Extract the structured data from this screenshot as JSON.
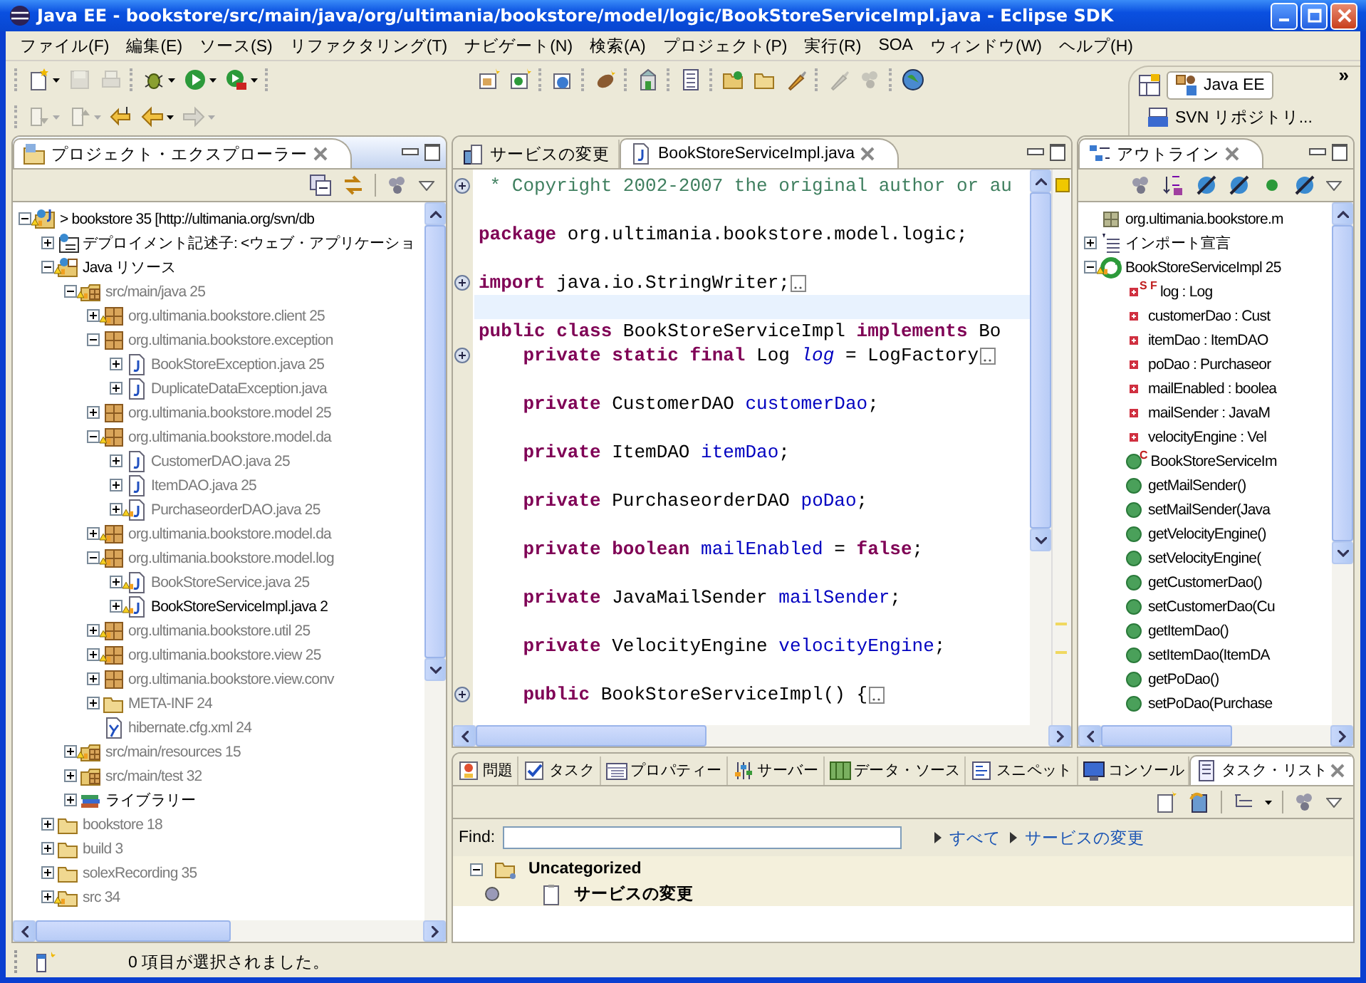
{
  "window": {
    "title": "Java EE - bookstore/src/main/java/org/ultimania/bookstore/model/logic/BookStoreServiceImpl.java - Eclipse SDK"
  },
  "menu": [
    "ファイル(F)",
    "編集(E)",
    "ソース(S)",
    "リファクタリング(T)",
    "ナビゲート(N)",
    "検索(A)",
    "プロジェクト(P)",
    "実行(R)",
    "SOA",
    "ウィンドウ(W)",
    "ヘルプ(H)"
  ],
  "toolbar": {
    "row_1": [
      [
        {
          "kind": "new",
          "enabled": true,
          "dropdown": true
        },
        {
          "kind": "save",
          "enabled": false,
          "dropdown": false
        },
        {
          "kind": "print",
          "enabled": false,
          "dropdown": false
        }
      ],
      [
        {
          "kind": "debug",
          "enabled": true,
          "dropdown": true
        },
        {
          "kind": "run",
          "enabled": true,
          "dropdown": true
        },
        {
          "kind": "ext",
          "enabled": true,
          "dropdown": true
        }
      ],
      [
        {
          "kind": "newpkg",
          "enabled": true,
          "dropdown": false
        },
        {
          "kind": "newclass",
          "enabled": true,
          "dropdown": false
        }
      ],
      [
        {
          "kind": "newweb",
          "enabled": true,
          "dropdown": false
        }
      ],
      [
        {
          "kind": "bean",
          "enabled": true,
          "dropdown": false
        }
      ],
      [
        {
          "kind": "server",
          "enabled": true,
          "dropdown": false
        }
      ],
      [
        {
          "kind": "doc",
          "enabled": true,
          "dropdown": false
        }
      ],
      [
        {
          "kind": "openfolder",
          "enabled": true,
          "dropdown": false
        },
        {
          "kind": "folder",
          "enabled": true,
          "dropdown": false
        },
        {
          "kind": "brush",
          "enabled": true,
          "dropdown": false
        }
      ],
      [
        {
          "kind": "brush",
          "enabled": false,
          "dropdown": false
        },
        {
          "kind": "balls",
          "enabled": false,
          "dropdown": false
        }
      ],
      [
        {
          "kind": "globe",
          "enabled": true,
          "dropdown": false
        }
      ]
    ],
    "row_2": [
      [
        {
          "kind": "down",
          "enabled": false,
          "dropdown": true
        },
        {
          "kind": "up",
          "enabled": false,
          "dropdown": true
        },
        {
          "kind": "lastedit",
          "enabled": true,
          "dropdown": false
        },
        {
          "kind": "back",
          "enabled": true,
          "dropdown": true
        },
        {
          "kind": "forward",
          "enabled": false,
          "dropdown": true
        }
      ]
    ]
  },
  "perspectives": {
    "items": [
      {
        "label": "Java EE",
        "selected": true
      },
      {
        "label": "SVN リポジトリ...",
        "selected": false
      }
    ],
    "more": "»"
  },
  "explorer": {
    "tab": "プロジェクト・エクスプローラー",
    "tree": [
      {
        "label": "> bookstore 35 [http://ultimania.org/svn/db",
        "kind": "project",
        "expanded": true,
        "warning": true,
        "dimmed": false,
        "children": [
          {
            "label": "デプロイメント記述子: <ウェブ・アプリケーショ",
            "kind": "deploy",
            "expanded": false,
            "warning": false,
            "dimmed": false
          },
          {
            "label": "Java リソース",
            "kind": "javares",
            "expanded": true,
            "warning": true,
            "dimmed": false,
            "children": [
              {
                "label": "src/main/java 25",
                "kind": "srcfolder",
                "expanded": true,
                "warning": true,
                "dimmed": true,
                "children": [
                  {
                    "label": "org.ultimania.bookstore.client 25",
                    "kind": "package",
                    "expanded": false,
                    "warning": true,
                    "dimmed": true
                  },
                  {
                    "label": "org.ultimania.bookstore.exception",
                    "kind": "package",
                    "expanded": true,
                    "warning": false,
                    "dimmed": true,
                    "children": [
                      {
                        "label": "BookStoreException.java 25",
                        "kind": "javafile",
                        "expanded": false,
                        "warning": false,
                        "dimmed": true
                      },
                      {
                        "label": "DuplicateDataException.java",
                        "kind": "javafile",
                        "expanded": false,
                        "warning": false,
                        "dimmed": true
                      }
                    ]
                  },
                  {
                    "label": "org.ultimania.bookstore.model 25",
                    "kind": "package",
                    "expanded": false,
                    "warning": false,
                    "dimmed": true
                  },
                  {
                    "label": "org.ultimania.bookstore.model.da",
                    "kind": "package",
                    "expanded": true,
                    "warning": true,
                    "dimmed": true,
                    "children": [
                      {
                        "label": "CustomerDAO.java 25",
                        "kind": "javafile",
                        "expanded": false,
                        "warning": false,
                        "dimmed": true
                      },
                      {
                        "label": "ItemDAO.java 25",
                        "kind": "javafile",
                        "expanded": false,
                        "warning": false,
                        "dimmed": true
                      },
                      {
                        "label": "PurchaseorderDAO.java 25",
                        "kind": "javafile",
                        "expanded": false,
                        "warning": true,
                        "dimmed": true
                      }
                    ]
                  },
                  {
                    "label": "org.ultimania.bookstore.model.da",
                    "kind": "package",
                    "expanded": false,
                    "warning": true,
                    "dimmed": true
                  },
                  {
                    "label": "org.ultimania.bookstore.model.log",
                    "kind": "package",
                    "expanded": true,
                    "warning": true,
                    "dimmed": true,
                    "children": [
                      {
                        "label": "BookStoreService.java 25",
                        "kind": "javafile",
                        "expanded": false,
                        "warning": true,
                        "dimmed": true
                      },
                      {
                        "label": "BookStoreServiceImpl.java 2",
                        "kind": "javafile",
                        "expanded": false,
                        "warning": true,
                        "dimmed": false
                      }
                    ]
                  },
                  {
                    "label": "org.ultimania.bookstore.util 25",
                    "kind": "package",
                    "expanded": false,
                    "warning": true,
                    "dimmed": true
                  },
                  {
                    "label": "org.ultimania.bookstore.view 25",
                    "kind": "package",
                    "expanded": false,
                    "warning": true,
                    "dimmed": true
                  },
                  {
                    "label": "org.ultimania.bookstore.view.conv",
                    "kind": "package",
                    "expanded": false,
                    "warning": false,
                    "dimmed": true
                  },
                  {
                    "label": "META-INF 24",
                    "kind": "folder",
                    "expanded": false,
                    "warning": false,
                    "dimmed": true
                  },
                  {
                    "label": "hibernate.cfg.xml 24",
                    "kind": "xml",
                    "warning": false,
                    "dimmed": true
                  }
                ]
              },
              {
                "label": "src/main/resources 15",
                "kind": "srcfolder",
                "expanded": false,
                "warning": true,
                "dimmed": true
              },
              {
                "label": "src/main/test 32",
                "kind": "srcfolder",
                "expanded": false,
                "warning": false,
                "dimmed": true
              },
              {
                "label": "ライブラリー",
                "kind": "library",
                "expanded": false,
                "warning": false,
                "dimmed": false
              }
            ]
          },
          {
            "label": "bookstore 18",
            "kind": "folder",
            "expanded": false,
            "warning": false,
            "dimmed": true
          },
          {
            "label": "build 3",
            "kind": "folder",
            "expanded": false,
            "warning": false,
            "dimmed": true
          },
          {
            "label": "solexRecording 35",
            "kind": "folder",
            "expanded": false,
            "warning": false,
            "dimmed": true
          },
          {
            "label": "src 34",
            "kind": "folder",
            "expanded": false,
            "warning": true,
            "dimmed": true
          }
        ]
      }
    ]
  },
  "editor": {
    "tabs": [
      {
        "label": "サービスの変更",
        "selected": false
      },
      {
        "label": "BookStoreServiceImpl.java",
        "selected": true
      }
    ],
    "lines": [
      {
        "fold": true,
        "box": false,
        "current": false,
        "tokens": [
          {
            "kind": "comment",
            "text": " * Copyright 2002-2007 the original author or au"
          }
        ]
      },
      {
        "fold": false,
        "box": false,
        "current": false
      },
      {
        "fold": false,
        "box": false,
        "current": false,
        "tokens": [
          {
            "kind": "kw",
            "text": "package"
          },
          {
            "kind": "plain",
            "text": " org.ultimania.bookstore.model.logic;"
          }
        ]
      },
      {
        "fold": false,
        "box": false,
        "current": false
      },
      {
        "fold": true,
        "box": true,
        "current": false,
        "tokens": [
          {
            "kind": "kw",
            "text": "import"
          },
          {
            "kind": "plain",
            "text": " java.io.StringWriter;"
          }
        ]
      },
      {
        "fold": false,
        "box": false,
        "current": true
      },
      {
        "fold": false,
        "box": false,
        "current": false,
        "tokens": [
          {
            "kind": "kw",
            "text": "public class"
          },
          {
            "kind": "plain",
            "text": " BookStoreServiceImpl "
          },
          {
            "kind": "kw",
            "text": "implements"
          },
          {
            "kind": "plain",
            "text": " Bo"
          }
        ]
      },
      {
        "fold": true,
        "box": true,
        "current": false,
        "tokens": [
          {
            "kind": "kw",
            "text": "    private static final"
          },
          {
            "kind": "plain",
            "text": " Log "
          },
          {
            "kind": "static",
            "text": "log"
          },
          {
            "kind": "plain",
            "text": " = LogFactory"
          }
        ]
      },
      {
        "fold": false,
        "box": false,
        "current": false
      },
      {
        "fold": false,
        "box": false,
        "current": false,
        "tokens": [
          {
            "kind": "kw",
            "text": "    private"
          },
          {
            "kind": "plain",
            "text": " CustomerDAO "
          },
          {
            "kind": "field",
            "text": "customerDao"
          },
          {
            "kind": "plain",
            "text": ";"
          }
        ]
      },
      {
        "fold": false,
        "box": false,
        "current": false
      },
      {
        "fold": false,
        "box": false,
        "current": false,
        "tokens": [
          {
            "kind": "kw",
            "text": "    private"
          },
          {
            "kind": "plain",
            "text": " ItemDAO "
          },
          {
            "kind": "field",
            "text": "itemDao"
          },
          {
            "kind": "plain",
            "text": ";"
          }
        ]
      },
      {
        "fold": false,
        "box": false,
        "current": false
      },
      {
        "fold": false,
        "box": false,
        "current": false,
        "tokens": [
          {
            "kind": "kw",
            "text": "    private"
          },
          {
            "kind": "plain",
            "text": " PurchaseorderDAO "
          },
          {
            "kind": "field",
            "text": "poDao"
          },
          {
            "kind": "plain",
            "text": ";"
          }
        ]
      },
      {
        "fold": false,
        "box": false,
        "current": false
      },
      {
        "fold": false,
        "box": false,
        "current": false,
        "tokens": [
          {
            "kind": "kw",
            "text": "    private boolean"
          },
          {
            "kind": "field",
            "text": " mailEnabled"
          },
          {
            "kind": "plain",
            "text": " = "
          },
          {
            "kind": "kw",
            "text": "false"
          },
          {
            "kind": "plain",
            "text": ";"
          }
        ]
      },
      {
        "fold": false,
        "box": false,
        "current": false
      },
      {
        "fold": false,
        "box": false,
        "current": false,
        "tokens": [
          {
            "kind": "kw",
            "text": "    private"
          },
          {
            "kind": "plain",
            "text": " JavaMailSender "
          },
          {
            "kind": "field",
            "text": "mailSender"
          },
          {
            "kind": "plain",
            "text": ";"
          }
        ]
      },
      {
        "fold": false,
        "box": false,
        "current": false
      },
      {
        "fold": false,
        "box": false,
        "current": false,
        "tokens": [
          {
            "kind": "kw",
            "text": "    private"
          },
          {
            "kind": "plain",
            "text": " VelocityEngine "
          },
          {
            "kind": "field",
            "text": "velocityEngine"
          },
          {
            "kind": "plain",
            "text": ";"
          }
        ]
      },
      {
        "fold": false,
        "box": false,
        "current": false
      },
      {
        "fold": true,
        "box": true,
        "current": false,
        "tokens": [
          {
            "kind": "kw",
            "text": "    public"
          },
          {
            "kind": "plain",
            "text": " BookStoreServiceImpl() {"
          }
        ]
      }
    ]
  },
  "outline": {
    "tab": "アウトライン",
    "tree": [
      {
        "label": "org.ultimania.bookstore.m",
        "kind": "pkgdecl",
        "warning": false
      },
      {
        "label": "インポート宣言",
        "kind": "imports",
        "expanded": false,
        "warning": false
      },
      {
        "label": "BookStoreServiceImpl 25",
        "kind": "class",
        "expanded": true,
        "warning": true,
        "children": [
          {
            "label": "log : Log",
            "kind": "field",
            "badge": "S F"
          },
          {
            "label": "customerDao : Cust",
            "kind": "field"
          },
          {
            "label": "itemDao : ItemDAO",
            "kind": "field"
          },
          {
            "label": "poDao : Purchaseor",
            "kind": "field"
          },
          {
            "label": "mailEnabled : boolea",
            "kind": "field"
          },
          {
            "label": "mailSender : JavaM",
            "kind": "field"
          },
          {
            "label": "velocityEngine : Vel",
            "kind": "field"
          },
          {
            "label": "BookStoreServiceIm",
            "kind": "method",
            "badge": "C"
          },
          {
            "label": "getMailSender()",
            "kind": "method"
          },
          {
            "label": "setMailSender(Java",
            "kind": "method"
          },
          {
            "label": "getVelocityEngine()",
            "kind": "method"
          },
          {
            "label": "setVelocityEngine(",
            "kind": "method"
          },
          {
            "label": "getCustomerDao()",
            "kind": "method"
          },
          {
            "label": "setCustomerDao(Cu",
            "kind": "method"
          },
          {
            "label": "getItemDao()",
            "kind": "method"
          },
          {
            "label": "setItemDao(ItemDA",
            "kind": "method"
          },
          {
            "label": "getPoDao()",
            "kind": "method"
          },
          {
            "label": "setPoDao(Purchase",
            "kind": "method"
          }
        ]
      }
    ]
  },
  "bottom": {
    "tabs": [
      {
        "label": "問題",
        "selected": false
      },
      {
        "label": "タスク",
        "selected": false
      },
      {
        "label": "プロパティー",
        "selected": false
      },
      {
        "label": "サーバー",
        "selected": false
      },
      {
        "label": "データ・ソース",
        "selected": false
      },
      {
        "label": "スニペット",
        "selected": false
      },
      {
        "label": "コンソール",
        "selected": false
      },
      {
        "label": "タスク・リスト",
        "selected": true
      }
    ],
    "find": {
      "label": "Find:"
    },
    "links": [
      "すべて",
      "サービスの変更"
    ],
    "categories": [
      {
        "label": "Uncategorized",
        "expanded": true,
        "tasks": [
          {
            "label": "サービスの変更"
          }
        ]
      }
    ]
  },
  "status_bar": {
    "message": "0 項目が選択されました。"
  }
}
